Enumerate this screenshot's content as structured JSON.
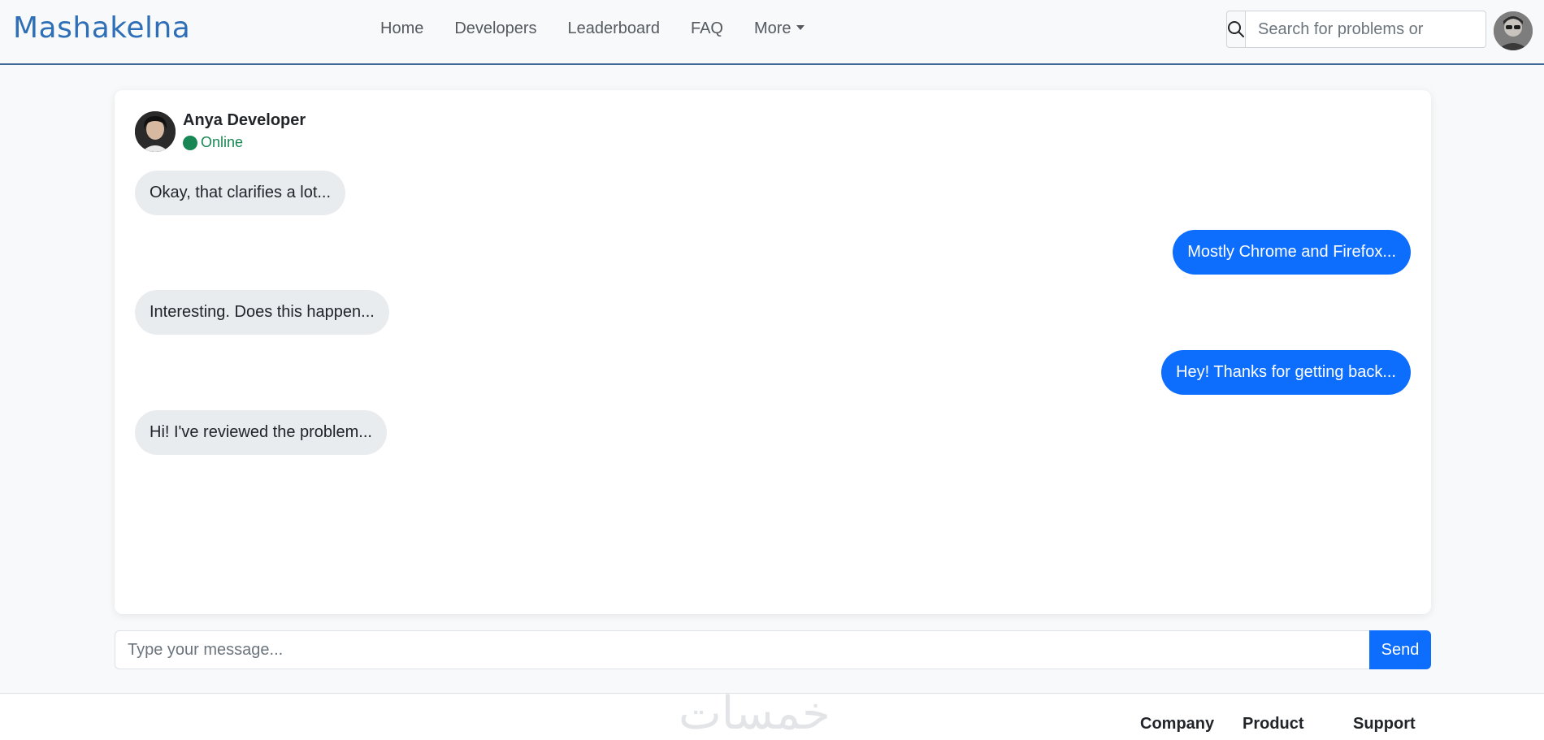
{
  "navbar": {
    "brand": "Mashakelna",
    "links": [
      {
        "label": "Home"
      },
      {
        "label": "Developers"
      },
      {
        "label": "Leaderboard"
      },
      {
        "label": "FAQ"
      },
      {
        "label": "More"
      }
    ],
    "search_placeholder": "Search for problems or"
  },
  "chat": {
    "contact_name": "Anya Developer",
    "status": "Online",
    "messages": [
      {
        "direction": "received",
        "text": "Okay, that clarifies a lot..."
      },
      {
        "direction": "sent",
        "text": "Mostly Chrome and Firefox..."
      },
      {
        "direction": "received",
        "text": "Interesting. Does this happen..."
      },
      {
        "direction": "sent",
        "text": "Hey! Thanks for getting back..."
      },
      {
        "direction": "received",
        "text": "Hi! I've reviewed the problem..."
      }
    ]
  },
  "composer": {
    "placeholder": "Type your message...",
    "send_label": "Send"
  },
  "footer": {
    "watermark": "خمسات",
    "columns": [
      "Company",
      "Product",
      "Support"
    ]
  },
  "colors": {
    "brand": "#2f6fb7",
    "sent_bubble": "#0d6efd",
    "received_bubble": "#e9ecef",
    "online": "#198754"
  }
}
